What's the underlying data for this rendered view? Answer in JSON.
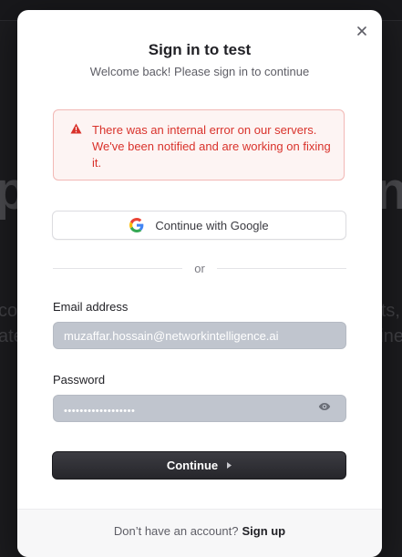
{
  "background": {
    "title_left": "p",
    "title_right": "n",
    "line1_left": "co",
    "line1_right": "ts,",
    "line2_left": "ate",
    "line2_right": "gine"
  },
  "modal": {
    "title": "Sign in to test",
    "subtitle": "Welcome back! Please sign in to continue",
    "close_icon": "close-icon"
  },
  "alert": {
    "icon": "warning-icon",
    "message": "There was an internal error on our servers. We've been notified and are working on fixing it.",
    "color": "#d9322b"
  },
  "google": {
    "label": "Continue with Google",
    "icon": "google-logo-icon"
  },
  "divider": {
    "label": "or"
  },
  "form": {
    "email_label": "Email address",
    "email_value": "muzaffar.hossain@networkintelligence.ai",
    "password_label": "Password",
    "password_mask": "••••••••••••••••••",
    "password_toggle_icon": "eye-icon"
  },
  "continue": {
    "label": "Continue",
    "icon": "caret-right-icon"
  },
  "footer": {
    "prompt": "Don’t have an account?",
    "link": "Sign up"
  }
}
